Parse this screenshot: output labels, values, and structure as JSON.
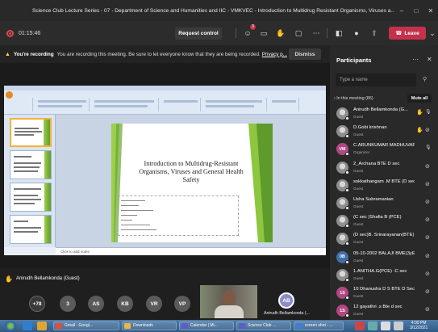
{
  "window": {
    "title": "Science Club Lecture Series - 07 - Department of Science and Humanities and IIC - VMKVEC - Introduction to Multidrug Resistant Organisms, Viruses a...",
    "controls": [
      "–",
      "□",
      "✕"
    ]
  },
  "toolbar": {
    "timer": "01:15:46",
    "request_control": "Request control",
    "chat_badge": "3",
    "leave_label": "Leave"
  },
  "recording_banner": {
    "bold": "You're recording",
    "message": "You are recording this meeting. Be sure to let everyone know that they are being recorded.",
    "link": "Privacy p...",
    "dismiss": "Dismiss"
  },
  "shared_screen": {
    "slide_title": "Introduction to Multidrug-Resistant Organisms, Viruses and General Health Safety",
    "notes_placeholder": "Click to add notes"
  },
  "speaker_label": "Anirudh Bellamkonda (Guest)",
  "bottom_avatars": [
    {
      "initials": "+78",
      "color": "#3b3a3a"
    },
    {
      "initials": "3",
      "color": "#5a5a5a"
    },
    {
      "initials": "AS",
      "color": "#5a5a5a"
    },
    {
      "initials": "KB",
      "color": "#5a5a5a"
    },
    {
      "initials": "VR",
      "color": "#5a5a5a"
    },
    {
      "initials": "VP",
      "color": "#5a5a5a"
    }
  ],
  "main_video": {
    "initials": "AB",
    "name": "Anirudh Bellamkonda (..."
  },
  "participants": {
    "title": "Participants",
    "search_placeholder": "Type a name",
    "section": "In this meeting (86)",
    "mute_all": "Mute all",
    "list": [
      {
        "name": "Anirudh Bellamkonda (G...",
        "role": "Guest",
        "avatar": "img",
        "hand": true,
        "mic": "on"
      },
      {
        "name": "D.Gobi krishnan",
        "role": "Guest",
        "avatar": "img",
        "hand": true,
        "mic": "off"
      },
      {
        "name": "C.ARUNKUMAR MADHUVAPP...",
        "role": "Organizer",
        "avatar": "VM",
        "avatar_color": "#b24782",
        "hand": false,
        "mic": "on"
      },
      {
        "name": "2_Archana BTE D sec",
        "role": "Guest",
        "avatar": "img",
        "hand": false,
        "mic": "off"
      },
      {
        "name": "sokkathangam .M BTE (D sec )",
        "role": "Guest",
        "avatar": "img",
        "hand": false,
        "mic": "off"
      },
      {
        "name": "Usha Subramanian",
        "role": "Guest",
        "avatar": "img",
        "hand": false,
        "mic": "off"
      },
      {
        "name": "(C sec )Shafia B (PCE)",
        "role": "Guest",
        "avatar": "img",
        "hand": false,
        "mic": "off"
      },
      {
        "name": "(D sec)B. Srinarayanan(BTE)",
        "role": "Guest",
        "avatar": "img",
        "hand": false,
        "mic": "off"
      },
      {
        "name": "05-10-2002 BALAJI BME(3yEAR",
        "role": "Guest",
        "avatar": "0B",
        "avatar_color": "#3f6fa8",
        "hand": false,
        "mic": "off"
      },
      {
        "name": "1.ANITHA.G(PCE) -C sec",
        "role": "Guest",
        "avatar": "img",
        "hand": false,
        "mic": "off"
      },
      {
        "name": "10 Dhanusha D S BTE D Sec",
        "role": "Guest",
        "avatar": "1S",
        "avatar_color": "#b24782",
        "hand": false,
        "mic": "off"
      },
      {
        "name": "12 gayathri .s Bte d sec",
        "role": "Guest",
        "avatar": "1S",
        "avatar_color": "#b24782",
        "hand": false,
        "mic": "off"
      }
    ]
  },
  "taskbar": {
    "items": [
      {
        "label": "Gmail - Googl...",
        "color": "#e44b3c"
      },
      {
        "label": "Downloads",
        "color": "#e8b84a"
      },
      {
        "label": "Calendar | Mi...",
        "color": "#5b5fc7"
      },
      {
        "label": "Science Club ...",
        "color": "#5b5fc7"
      },
      {
        "label": "screen shot - ...",
        "color": "#3d7fd0"
      }
    ],
    "time": "4:00 PM",
    "date": "3/12/2021"
  }
}
